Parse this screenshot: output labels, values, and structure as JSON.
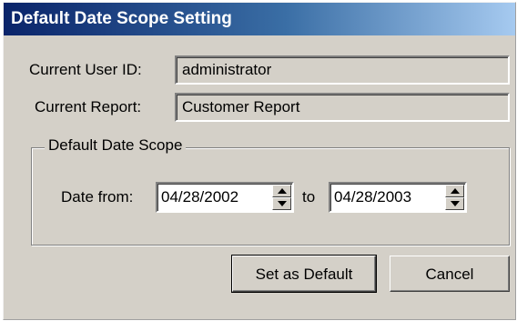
{
  "window": {
    "title": "Default Date Scope Setting"
  },
  "user": {
    "label": "Current User ID:",
    "value": "administrator"
  },
  "report": {
    "label": "Current Report:",
    "value": "Customer Report"
  },
  "date_scope": {
    "group_label": "Default Date Scope",
    "from_label": "Date from:",
    "from_value": "04/28/2002",
    "to_label": "to",
    "to_value": "04/28/2003"
  },
  "buttons": {
    "set_default": "Set as Default",
    "cancel": "Cancel"
  },
  "colors": {
    "title_gradient_start": "#0a246a",
    "title_gradient_end": "#a6caf0",
    "dialog_face": "#d4d0c8"
  },
  "icons": {
    "spin_up": "spin-up-arrow-icon",
    "spin_down": "spin-down-arrow-icon"
  }
}
